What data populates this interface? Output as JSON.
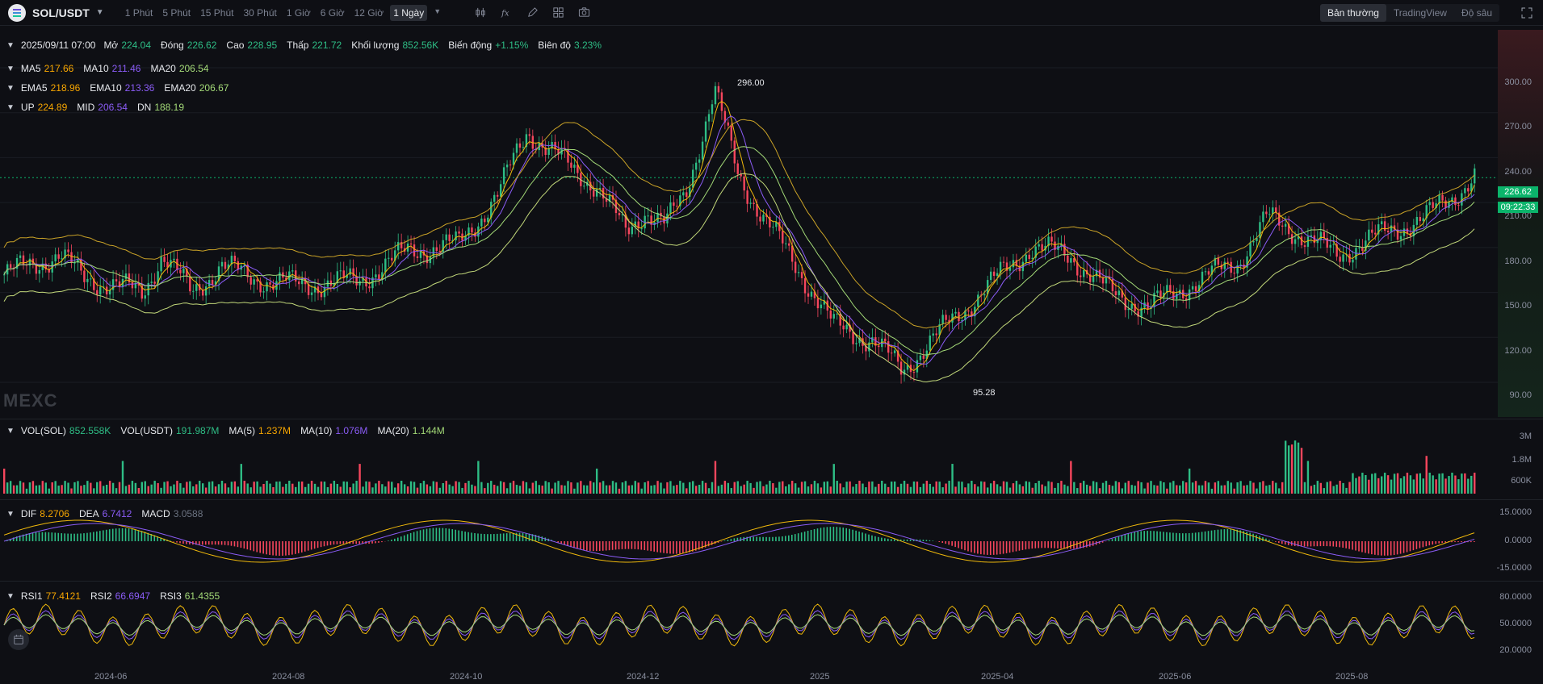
{
  "header": {
    "pair": "SOL/USDT",
    "intervals": [
      "1 Phút",
      "5 Phút",
      "15 Phút",
      "30 Phút",
      "1 Giờ",
      "6 Giờ",
      "12 Giờ",
      "1 Ngày"
    ],
    "active_interval": "1 Ngày",
    "tools": [
      "candles-icon",
      "formula-icon",
      "pencil-icon",
      "layout-icon",
      "camera-icon"
    ],
    "view_tabs": [
      "Bản thường",
      "TradingView",
      "Độ sâu"
    ],
    "active_view": "Bản thường"
  },
  "ohlc": {
    "date": "2025/09/11 07:00",
    "open_label": "Mở",
    "open": "224.04",
    "close_label": "Đóng",
    "close": "226.62",
    "high_label": "Cao",
    "high": "228.95",
    "low_label": "Thấp",
    "low": "221.72",
    "volume_label": "Khối lượng",
    "volume": "852.56K",
    "change_label": "Biến động",
    "change": "+1.15%",
    "amplitude_label": "Biên độ",
    "amplitude": "3.23%"
  },
  "ma": {
    "ma5_label": "MA5",
    "ma5": "217.66",
    "ma10_label": "MA10",
    "ma10": "211.46",
    "ma20_label": "MA20",
    "ma20": "206.54"
  },
  "ema": {
    "ema5_label": "EMA5",
    "ema5": "218.96",
    "ema10_label": "EMA10",
    "ema10": "213.36",
    "ema20_label": "EMA20",
    "ema20": "206.67"
  },
  "boll": {
    "up_label": "UP",
    "up": "224.89",
    "mid_label": "MID",
    "mid": "206.54",
    "dn_label": "DN",
    "dn": "188.19"
  },
  "vol": {
    "sol_label": "VOL(SOL)",
    "sol": "852.558K",
    "usdt_label": "VOL(USDT)",
    "usdt": "191.987M",
    "ma5_label": "MA(5)",
    "ma5": "1.237M",
    "ma10_label": "MA(10)",
    "ma10": "1.076M",
    "ma20_label": "MA(20)",
    "ma20": "1.144M"
  },
  "macd": {
    "dif_label": "DIF",
    "dif": "8.2706",
    "dea_label": "DEA",
    "dea": "6.7412",
    "macd_label": "MACD",
    "macd": "3.0588"
  },
  "rsi": {
    "rsi1_label": "RSI1",
    "rsi1": "77.4121",
    "rsi2_label": "RSI2",
    "rsi2": "66.6947",
    "rsi3_label": "RSI3",
    "rsi3": "61.4355"
  },
  "price_axis": [
    "300.00",
    "270.00",
    "240.00",
    "210.00",
    "180.00",
    "150.00",
    "120.00",
    "90.00"
  ],
  "vol_axis": [
    "3M",
    "1.8M",
    "600K"
  ],
  "macd_axis": [
    "15.0000",
    "0.0000",
    "-15.0000"
  ],
  "rsi_axis": [
    "80.0000",
    "50.0000",
    "20.0000"
  ],
  "current_price": "226.62",
  "countdown": "09:22:33",
  "high_marker": "296.00",
  "low_marker": "95.28",
  "x_axis": [
    "2024-06",
    "2024-08",
    "2024-10",
    "2024-12",
    "2025",
    "2025-04",
    "2025-06",
    "2025-08"
  ],
  "watermark": "MEXC",
  "colors": {
    "up": "#2ebd85",
    "down": "#f6465d",
    "ma5": "#f0b90b",
    "ma10": "#8b5cf6",
    "ma20": "#a3d977",
    "bg": "#0e0f14"
  }
}
